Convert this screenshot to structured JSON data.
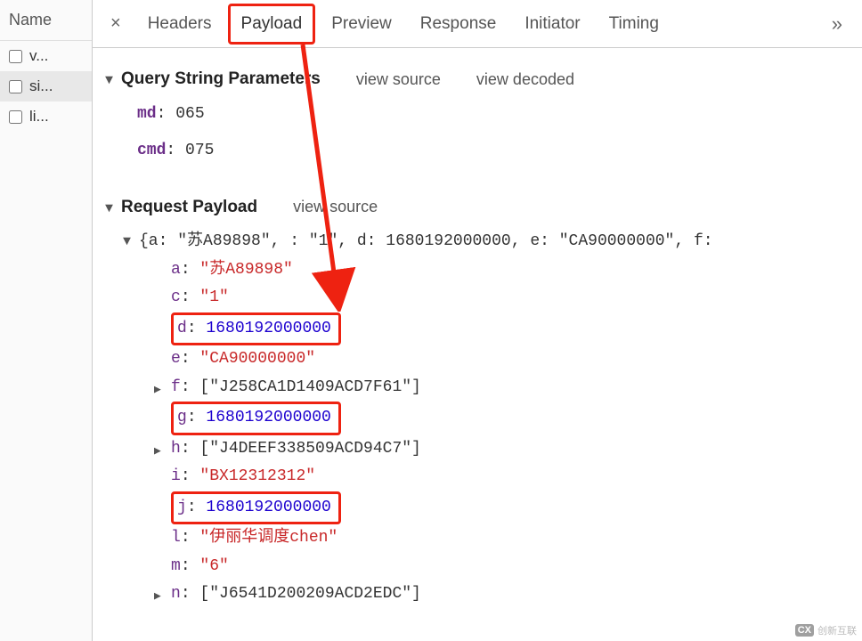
{
  "sidebar": {
    "header": "Name",
    "items": [
      {
        "label": "v..."
      },
      {
        "label": "si..."
      },
      {
        "label": "li..."
      }
    ]
  },
  "tabs": {
    "close_glyph": "×",
    "items": [
      "Headers",
      "Payload",
      "Preview",
      "Response",
      "Initiator",
      "Timing"
    ],
    "active_index": 1,
    "overflow_glyph": "»"
  },
  "query_string": {
    "title": "Query String Parameters",
    "view_source": "view source",
    "view_decoded": "view decoded",
    "params": [
      {
        "key": "md",
        "value": "065"
      },
      {
        "key": "cmd",
        "value": "075"
      }
    ]
  },
  "request_payload": {
    "title": "Request Payload",
    "view_source": "view source",
    "summary_prefix": "{a: ",
    "summary_a": "\"苏A89898\"",
    "summary_mid1": ",   : ",
    "summary_c": "\"1\"",
    "summary_mid2": ", d: ",
    "summary_d": "1680192000000",
    "summary_mid3": ", e: ",
    "summary_e": "\"CA90000000\"",
    "summary_tail": ", f:",
    "props": {
      "a": {
        "k": "a",
        "v": "\"苏A89898\"",
        "type": "str"
      },
      "c": {
        "k": "c",
        "v": "\"1\"",
        "type": "str"
      },
      "d": {
        "k": "d",
        "v": "1680192000000",
        "type": "num",
        "boxed": true
      },
      "e": {
        "k": "e",
        "v": "\"CA90000000\"",
        "type": "str"
      },
      "f": {
        "k": "f",
        "v": "[\"J258CA1D1409ACD7F61\"]",
        "type": "arr",
        "expandable": true
      },
      "g": {
        "k": "g",
        "v": "1680192000000",
        "type": "num",
        "boxed": true
      },
      "h": {
        "k": "h",
        "v": "[\"J4DEEF338509ACD94C7\"]",
        "type": "arr",
        "expandable": true
      },
      "i": {
        "k": "i",
        "v": "\"BX12312312\"",
        "type": "str"
      },
      "j": {
        "k": "j",
        "v": "1680192000000",
        "type": "num",
        "boxed": true
      },
      "l": {
        "k": "l",
        "v": "\"伊丽华调度chen\"",
        "type": "str"
      },
      "m": {
        "k": "m",
        "v": "\"6\"",
        "type": "str"
      },
      "n": {
        "k": "n",
        "v": "[\"J6541D200209ACD2EDC\"]",
        "type": "arr",
        "expandable": true
      }
    }
  },
  "watermark": {
    "badge": "CX",
    "text": "创新互联"
  },
  "annotation": {
    "highlight_tab": "Payload",
    "highlight_keys": [
      "d",
      "g",
      "j"
    ],
    "arrow_color": "#e21"
  }
}
